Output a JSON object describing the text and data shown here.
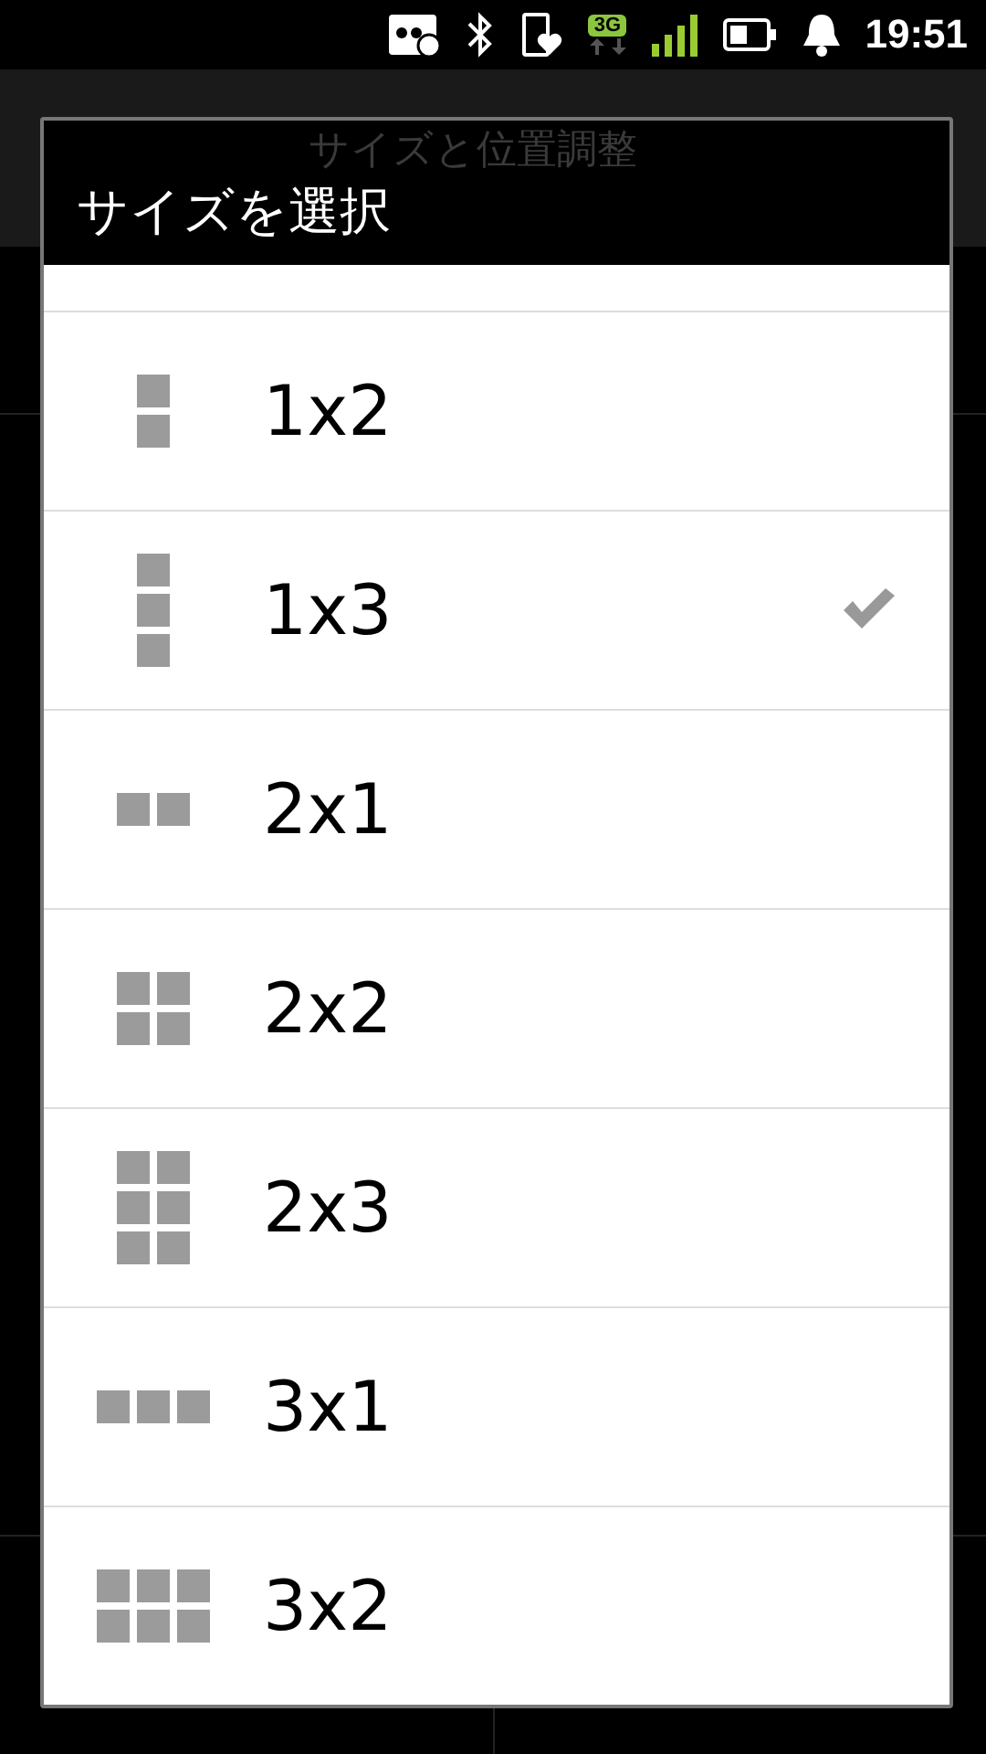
{
  "status_bar": {
    "network_badge": "3G",
    "time": "19:51"
  },
  "background": {
    "title": "サイズと位置調整"
  },
  "dialog": {
    "title": "サイズを選択",
    "items": [
      {
        "label": "1x2",
        "kind": "tall2",
        "selected": false
      },
      {
        "label": "1x3",
        "kind": "tall3",
        "selected": true
      },
      {
        "label": "2x1",
        "kind": "wide2",
        "selected": false
      },
      {
        "label": "2x2",
        "kind": "square2",
        "selected": false
      },
      {
        "label": "2x3",
        "kind": "block2x3",
        "selected": false
      },
      {
        "label": "3x1",
        "kind": "wide3",
        "selected": false
      },
      {
        "label": "3x2",
        "kind": "block3x2",
        "selected": false
      }
    ]
  }
}
